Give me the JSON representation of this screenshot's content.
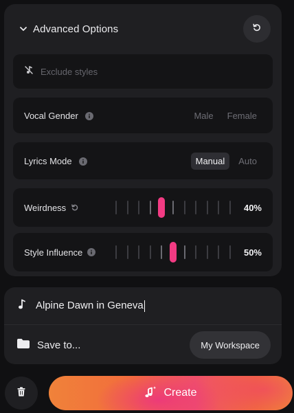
{
  "advanced": {
    "title": "Advanced Options",
    "exclude_placeholder": "Exclude styles",
    "vocal_gender": {
      "label": "Vocal Gender",
      "options": [
        "Male",
        "Female"
      ]
    },
    "lyrics_mode": {
      "label": "Lyrics Mode",
      "options": [
        "Manual",
        "Auto"
      ],
      "selected": "Manual"
    },
    "weirdness": {
      "label": "Weirdness",
      "value_text": "40%",
      "value": 0.4
    },
    "style_influence": {
      "label": "Style Influence",
      "value_text": "50%",
      "value": 0.5
    }
  },
  "song": {
    "title": "Alpine Dawn in Geneva",
    "save_label": "Save to...",
    "workspace_button": "My Workspace"
  },
  "actions": {
    "create_label": "Create"
  },
  "colors": {
    "accent": "#f23b83",
    "panel": "#1f1f22",
    "row": "#141416"
  }
}
